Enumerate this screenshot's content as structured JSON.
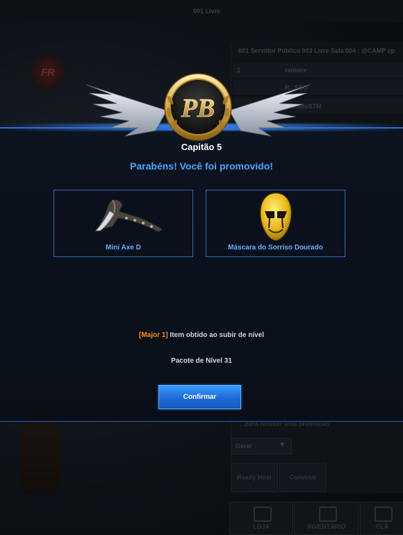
{
  "background": {
    "top_text": "001 Livre",
    "logo_text": "FR",
    "server_title": "001 Servidor Público 003 Livre Sala 004 : @CAMP cp",
    "players": [
      {
        "num": "1",
        "name": "ramace"
      },
      {
        "num": "",
        "name": "R...SSO"
      },
      {
        "num": "",
        "name": "...adoSTM"
      }
    ],
    "chat_text": "...para receber uma promoção",
    "filter_value": "Geral",
    "buttons": [
      "Ready Host",
      "Convidar"
    ],
    "bottom_tabs": [
      "LOJA",
      "INVENTÁRIO",
      "CLÃ"
    ]
  },
  "modal": {
    "emblem_text": "PB",
    "rank_title": "Capitão 5",
    "promotion_message": "Parabéns! Você foi promovido!",
    "rewards": [
      {
        "label": "Mini Axe D",
        "icon": "axe-icon"
      },
      {
        "label": "Máscara do Sorriso Dourado",
        "icon": "golden-mask-icon"
      }
    ],
    "level_tag": "[Major 1]",
    "level_text": " Item obtido ao subir de nível",
    "package_text": "Pacote de Nível 31",
    "confirm_label": "Confirmar"
  },
  "colors": {
    "accent_blue": "#4ea3ff",
    "level_tag_orange": "#ff8a1e",
    "button_blue": "#1c6ad8"
  }
}
